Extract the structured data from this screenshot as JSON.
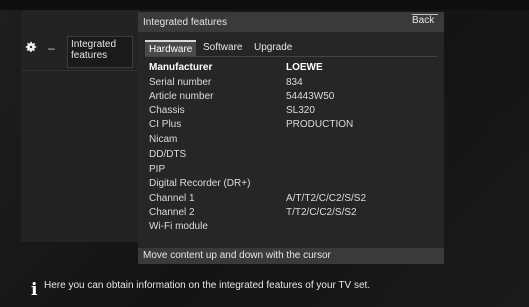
{
  "window": {
    "title": "Integrated features",
    "back_label": "Back"
  },
  "sidebar": {
    "item_label": "Integrated features",
    "dash": "–"
  },
  "tabs": [
    {
      "label": "Hardware",
      "active": true
    },
    {
      "label": "Software",
      "active": false
    },
    {
      "label": "Upgrade",
      "active": false
    }
  ],
  "table": {
    "rows": [
      {
        "label": "Manufacturer",
        "value": "LOEWE"
      },
      {
        "label": "Serial number",
        "value": "834"
      },
      {
        "label": "Article number",
        "value": "54443W50"
      },
      {
        "label": "Chassis",
        "value": "SL320"
      },
      {
        "label": "CI Plus",
        "value": "PRODUCTION"
      },
      {
        "label": "Nicam",
        "value": ""
      },
      {
        "label": "DD/DTS",
        "value": ""
      },
      {
        "label": "PIP",
        "value": ""
      },
      {
        "label": "Digital Recorder (DR+)",
        "value": ""
      },
      {
        "label": "Channel 1",
        "value": "A/T/T2/C/C2/S/S2"
      },
      {
        "label": "Channel 2",
        "value": "T/T2/C/C2/S/S2"
      },
      {
        "label": "Wi-Fi module",
        "value": ""
      }
    ]
  },
  "hint": "Move content up and down with the cursor",
  "info": "Here you can obtain information on the integrated features of your TV set.",
  "icons": {
    "settings": "gear-icon",
    "info": "info-icon"
  },
  "colors": {
    "background": "#161616",
    "panel": "#262626",
    "header": "#3a3a3a",
    "text": "#e6e6e6"
  }
}
